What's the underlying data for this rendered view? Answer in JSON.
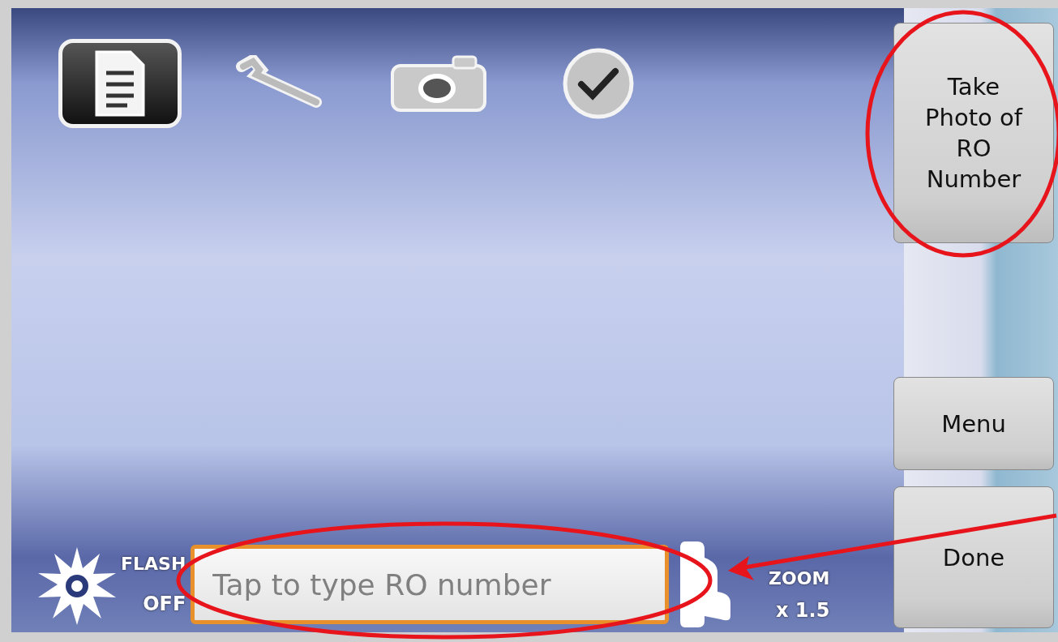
{
  "toolbar": [
    {
      "kind": "document",
      "selected": true
    },
    {
      "kind": "wrench",
      "selected": false
    },
    {
      "kind": "camera",
      "selected": false
    },
    {
      "kind": "check",
      "selected": false
    }
  ],
  "flash": {
    "label": "FLASH",
    "state": "OFF"
  },
  "ro_field": {
    "placeholder": "Tap to type RO number"
  },
  "zoom": {
    "label": "ZOOM",
    "value": "x 1.5"
  },
  "buttons": [
    {
      "kind": "take-photo",
      "label": "Take Photo of RO Number"
    },
    {
      "kind": "menu",
      "label": "Menu"
    },
    {
      "kind": "done",
      "label": "Done"
    }
  ]
}
